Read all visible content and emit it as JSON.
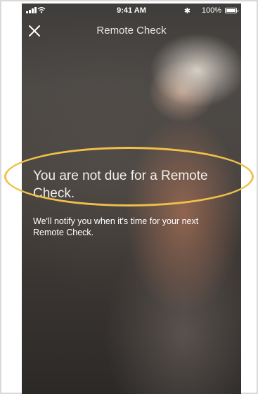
{
  "status_bar": {
    "time": "9:41 AM",
    "bluetooth": "✱",
    "battery": "100%"
  },
  "nav": {
    "title": "Remote Check",
    "close_icon": "close-icon"
  },
  "main": {
    "headline": "You are not due for a Remote Check.",
    "message": "We'll notify you when it's time for your next Remote Check."
  },
  "colors": {
    "highlight": "#f0c04a",
    "text": "#ffffff"
  }
}
